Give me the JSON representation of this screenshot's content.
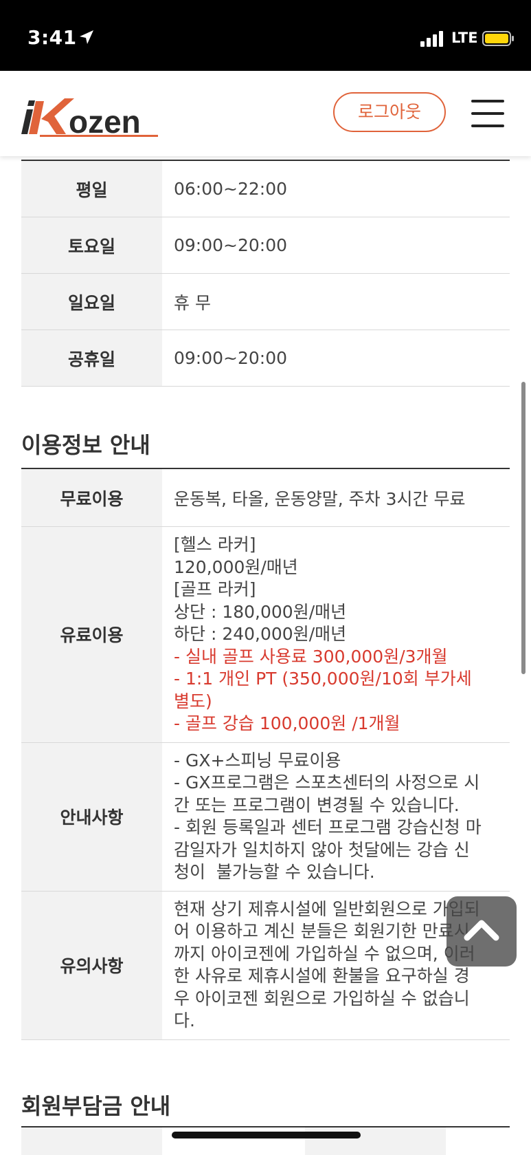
{
  "status_bar": {
    "time": "3:41",
    "network": "LTE"
  },
  "header": {
    "logo_text": "iKozen",
    "logout_label": "로그아웃",
    "brand_color": "#e0633a"
  },
  "hours_table": [
    {
      "label": "평일",
      "value": "06:00~22:00"
    },
    {
      "label": "토요일",
      "value": "09:00~20:00"
    },
    {
      "label": "일요일",
      "value": "휴 무"
    },
    {
      "label": "공휴일",
      "value": "09:00~20:00"
    }
  ],
  "usage_info": {
    "title": "이용정보 안내",
    "free": {
      "label": "무료이용",
      "value": "운동복, 타올, 운동양말, 주차 3시간 무료"
    },
    "paid": {
      "label": "유료이용",
      "lines": [
        "[헬스 라커]",
        "120,000원/매년",
        "[골프 라커]",
        "상단 : 180,000원/매년",
        "하단 : 240,000원/매년"
      ],
      "red_lines": [
        "- 실내 골프 사용료 300,000원/3개월",
        "- 1:1 개인 PT (350,000원/10회 부가세",
        "별도)",
        "- 골프 강습 100,000원 /1개월"
      ]
    },
    "notice": {
      "label": "안내사항",
      "lines": [
        "- GX+스피닝 무료이용",
        "- GX프로그램은 스포츠센터의 사정으로 시",
        "간 또는 프로그램이 변경될 수 있습니다.",
        "- 회원 등록일과 센터 프로그램 강습신청 마",
        "감일자가 일치하지 않아 첫달에는 강습 신",
        "청이  불가능할 수 있습니다."
      ]
    },
    "caution": {
      "label": "유의사항",
      "lines": [
        "현재 상기 제휴시설에 일반회원으로 가입되",
        "어 이용하고 계신 분들은 회원기한 만료시",
        "까지 아이코젠에 가입하실 수 없으며, 이러",
        "한 사유로 제휴시설에 환불을 요구하실 경",
        "우 아이코젠 회원으로 가입하실 수 없습니",
        "다."
      ]
    }
  },
  "fee_section": {
    "title": "회원부담금 안내"
  }
}
